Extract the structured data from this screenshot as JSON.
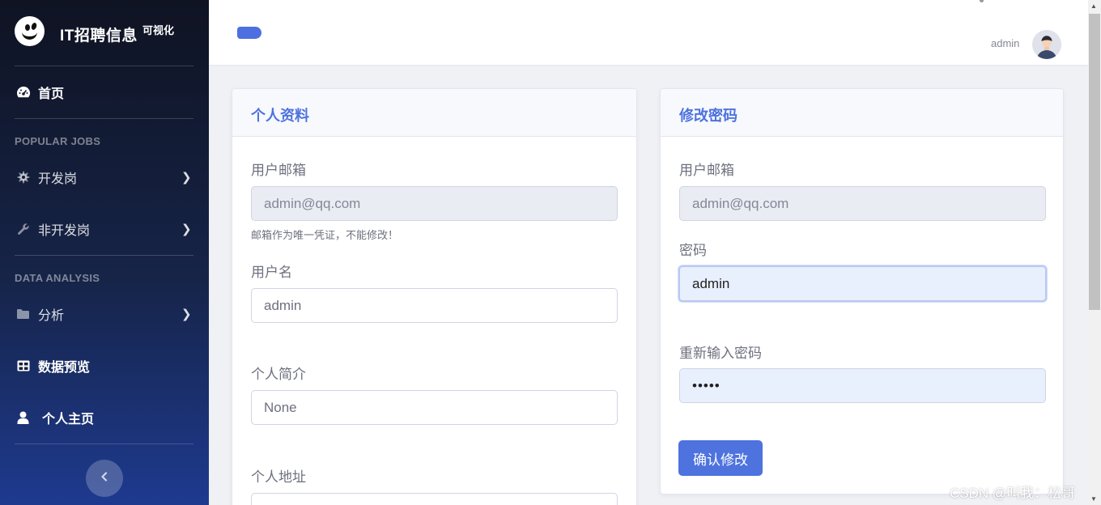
{
  "brand": {
    "title": "IT招聘信息",
    "sup": "可视化"
  },
  "sidebar": {
    "home": "首页",
    "section_popular": "POPULAR JOBS",
    "dev_jobs": "开发岗",
    "nondev_jobs": "非开发岗",
    "section_data": "DATA ANALYSIS",
    "analysis": "分析",
    "data_preview": "数据预览",
    "profile_page": "个人主页"
  },
  "topbar": {
    "user": "admin"
  },
  "profile": {
    "title": "个人资料",
    "email_label": "用户邮箱",
    "email_value": "admin@qq.com",
    "email_hint": "邮箱作为唯一凭证，不能修改！",
    "username_label": "用户名",
    "username_value": "admin",
    "bio_label": "个人简介",
    "bio_value": "None",
    "address_label": "个人地址"
  },
  "password": {
    "title": "修改密码",
    "email_label": "用户邮箱",
    "email_value": "admin@qq.com",
    "password_label": "密码",
    "password_value": "admin",
    "repeat_label": "重新输入密码",
    "repeat_value": "•••••",
    "submit_label": "确认修改"
  },
  "watermark": "CSDN @叫我：松哥",
  "colors": {
    "accent": "#4e73df",
    "sidebar_top": "#0f1322",
    "sidebar_bottom": "#1e3a8f"
  }
}
